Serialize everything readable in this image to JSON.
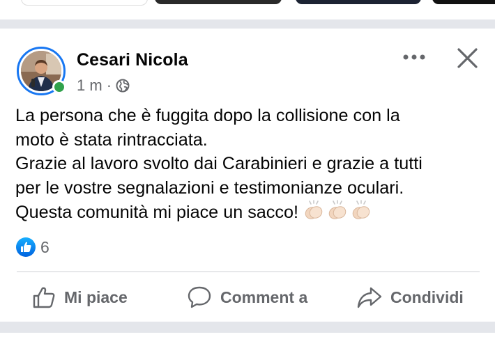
{
  "post": {
    "author": "Cesari Nicola",
    "time": "1 m",
    "separator": "·",
    "lines": [
      "La persona che è fuggita dopo la collisione con la",
      "moto è stata rintracciata.",
      "Grazie al lavoro svolto dai Carabinieri e grazie a tutti",
      "per le vostre segnalazioni e testimonianze oculari.",
      "Questa comunità mi piace un sacco!"
    ],
    "emoji": [
      "👏🏻",
      "👏🏻",
      "👏🏻"
    ],
    "privacy_icon": "globe-icon",
    "online": true
  },
  "reactions": {
    "icon": "like-icon",
    "count": "6"
  },
  "actions": {
    "like_label": "Mi piace",
    "comment_label": "Comment a",
    "share_label": "Condividi"
  },
  "colors": {
    "brand_blue": "#1877f2",
    "online_green": "#31a24c",
    "secondary_text": "#65676b",
    "separator": "#e4e6eb"
  }
}
